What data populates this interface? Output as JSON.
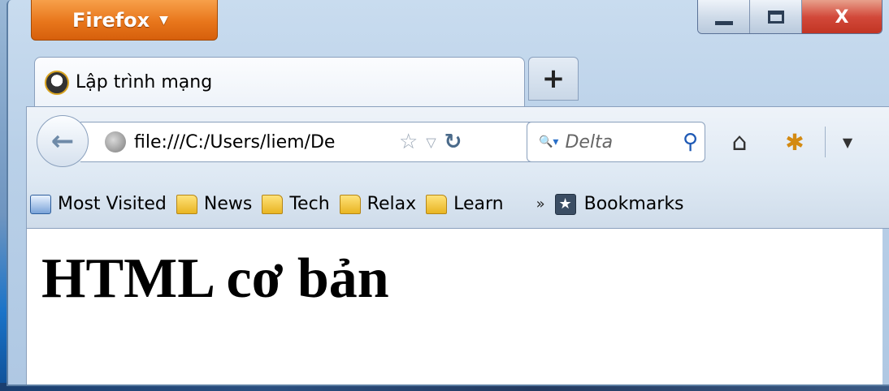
{
  "window": {
    "app_button_label": "Firefox",
    "close_glyph": "X"
  },
  "tabs": [
    {
      "title": "Lập trình mạng"
    }
  ],
  "new_tab_glyph": "+",
  "navigation": {
    "back_glyph": "←",
    "url": "file:///C:/Users/liem/De",
    "search_placeholder": "Delta",
    "icons": {
      "site": "globe-icon",
      "bookmark_star": "star-icon",
      "history": "dropdown-icon",
      "reload": "reload-icon",
      "search": "magnifier-icon",
      "home": "home-icon",
      "addon": "ladybug-icon"
    }
  },
  "bookmarks_toolbar": {
    "items": [
      {
        "label": "Most Visited",
        "icon": "most-visited-icon"
      },
      {
        "label": "News",
        "icon": "folder-icon"
      },
      {
        "label": "Tech",
        "icon": "folder-icon"
      },
      {
        "label": "Relax",
        "icon": "folder-icon"
      },
      {
        "label": "Learn",
        "icon": "folder-icon"
      }
    ],
    "overflow_glyph": "»",
    "bookmarks_label": "Bookmarks"
  },
  "page": {
    "heading": "HTML cơ bản"
  },
  "colors": {
    "firefox_orange": "#e8761b",
    "chrome_blue": "#dde8f3",
    "close_red": "#d2493a"
  }
}
